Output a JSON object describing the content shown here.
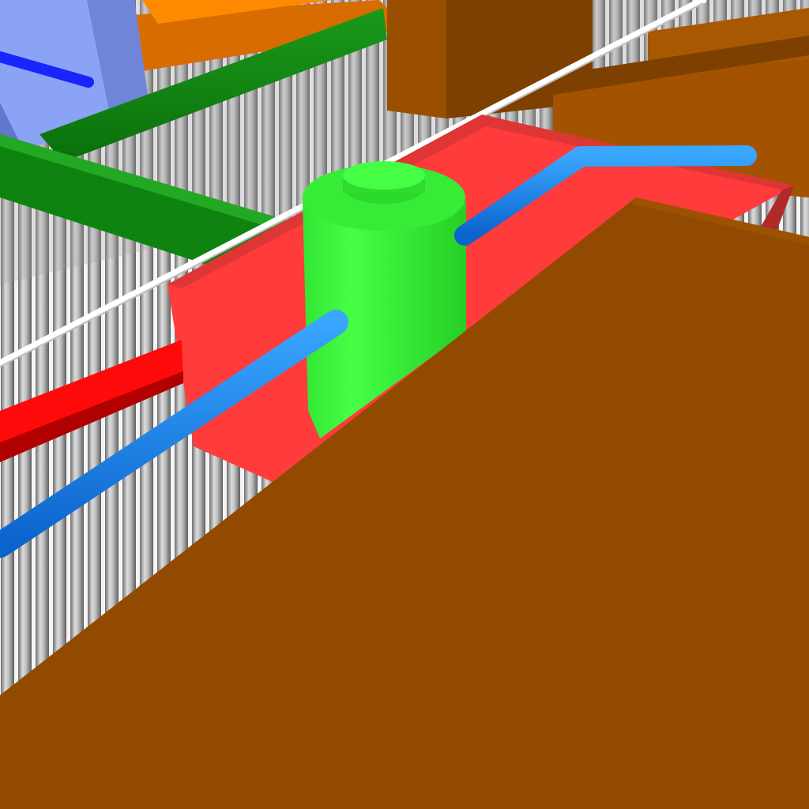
{
  "scene": {
    "colors": {
      "background": "#000000",
      "tube_light": "#cfcfcf",
      "tube_shadow": "#7a7a7a",
      "tube_gap": "#f2f2f2",
      "brown_box": "#914a00",
      "brown_box_top": "#9c5200",
      "brown_box_shade": "#7e4000",
      "red_panel": "#ff3b3b",
      "red_panel_top": "#de3535",
      "green_cylinder": "#3cf23c",
      "green_cylinder_shade": "#2ad92a",
      "green_pipe": "#118c11",
      "green_pipe_light": "#1faa1f",
      "blue_pipe": "#1f8bff",
      "blue_pipe_shade": "#0a66d0",
      "white_wire": "#ffffff",
      "red_pipe": "#ff0a0a",
      "lavender_block": "#7f97ea",
      "lavender_block_front": "#98afff",
      "orange_bar": "#e87400",
      "dark_blue_rod": "#1a24ff"
    },
    "objects": [
      "vertical-tube-array",
      "large-brown-box",
      "back-brown-boxes",
      "red-panel",
      "green-cylinder-pillar",
      "green-horizontal-pipe",
      "blue-pipe",
      "red-pipe",
      "white-wire",
      "lavender-block",
      "orange-bar",
      "dark-blue-rod"
    ]
  }
}
